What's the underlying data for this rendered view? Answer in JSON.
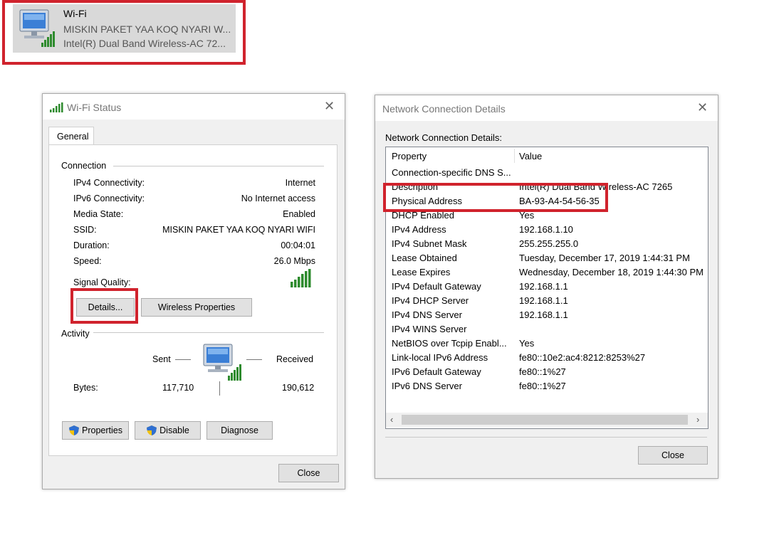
{
  "tile": {
    "name": "Wi-Fi",
    "network": "MISKIN PAKET YAA KOQ NYARI W...",
    "adapter": "Intel(R) Dual Band Wireless-AC 72..."
  },
  "status_window": {
    "title": "Wi-Fi Status",
    "tab": "General",
    "connection_heading": "Connection",
    "rows": [
      {
        "label": "IPv4 Connectivity:",
        "value": "Internet"
      },
      {
        "label": "IPv6 Connectivity:",
        "value": "No Internet access"
      },
      {
        "label": "Media State:",
        "value": "Enabled"
      },
      {
        "label": "SSID:",
        "value": "MISKIN PAKET YAA KOQ NYARI WIFI"
      },
      {
        "label": "Duration:",
        "value": "00:04:01"
      },
      {
        "label": "Speed:",
        "value": "26.0 Mbps"
      }
    ],
    "signal_label": "Signal Quality:",
    "details_button": "Details...",
    "wireless_properties_button": "Wireless Properties",
    "activity_heading": "Activity",
    "sent_label": "Sent",
    "received_label": "Received",
    "bytes_label": "Bytes:",
    "bytes_sent": "117,710",
    "bytes_received": "190,612",
    "properties_button": "Properties",
    "disable_button": "Disable",
    "diagnose_button": "Diagnose",
    "close_button": "Close"
  },
  "details_window": {
    "title": "Network Connection Details",
    "subtitle": "Network Connection Details:",
    "col_property": "Property",
    "col_value": "Value",
    "rows": [
      {
        "p": "Connection-specific DNS S...",
        "v": ""
      },
      {
        "p": "Description",
        "v": "Intel(R) Dual Band Wireless-AC 7265"
      },
      {
        "p": "Physical Address",
        "v": "BA-93-A4-54-56-35"
      },
      {
        "p": "DHCP Enabled",
        "v": "Yes"
      },
      {
        "p": "IPv4 Address",
        "v": "192.168.1.10"
      },
      {
        "p": "IPv4 Subnet Mask",
        "v": "255.255.255.0"
      },
      {
        "p": "Lease Obtained",
        "v": "Tuesday, December 17, 2019 1:44:31 PM"
      },
      {
        "p": "Lease Expires",
        "v": "Wednesday, December 18, 2019 1:44:30 PM"
      },
      {
        "p": "IPv4 Default Gateway",
        "v": "192.168.1.1"
      },
      {
        "p": "IPv4 DHCP Server",
        "v": "192.168.1.1"
      },
      {
        "p": "IPv4 DNS Server",
        "v": "192.168.1.1"
      },
      {
        "p": "IPv4 WINS Server",
        "v": ""
      },
      {
        "p": "NetBIOS over Tcpip Enabl...",
        "v": "Yes"
      },
      {
        "p": "Link-local IPv6 Address",
        "v": "fe80::10e2:ac4:8212:8253%27"
      },
      {
        "p": "IPv6 Default Gateway",
        "v": "fe80::1%27"
      },
      {
        "p": "IPv6 DNS Server",
        "v": "fe80::1%27"
      }
    ],
    "close_button": "Close"
  },
  "colors": {
    "highlight_red": "#d0232d",
    "signal_green": "#2e8b2e",
    "monitor_blue": "#3b7fd6"
  }
}
